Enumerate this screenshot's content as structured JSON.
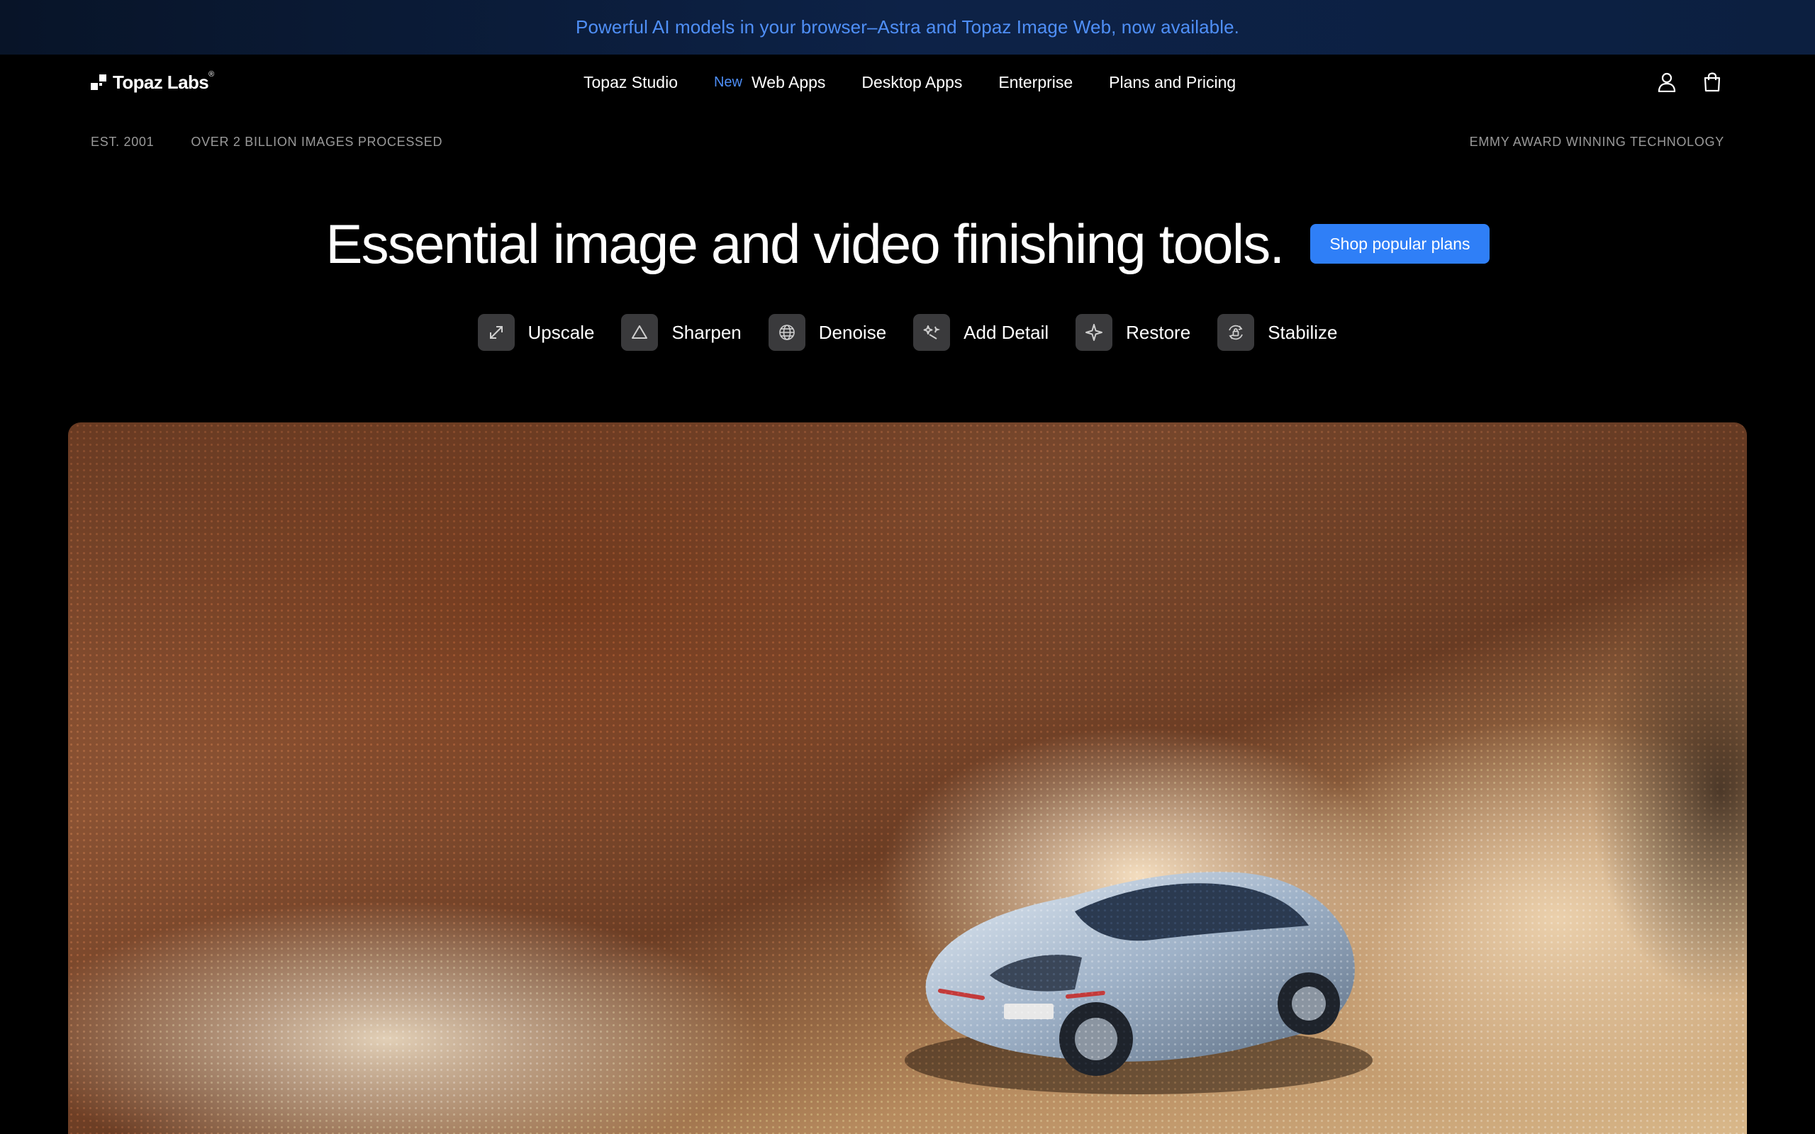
{
  "banner": {
    "text": "Powerful AI models in your browser–Astra and Topaz Image Web, now available."
  },
  "header": {
    "logo_text": "Topaz Labs",
    "logo_mark": "®",
    "nav": [
      {
        "label": "Topaz Studio",
        "badge": ""
      },
      {
        "label": "Web Apps",
        "badge": "New"
      },
      {
        "label": "Desktop Apps",
        "badge": ""
      },
      {
        "label": "Enterprise",
        "badge": ""
      },
      {
        "label": "Plans and Pricing",
        "badge": ""
      }
    ],
    "icons": [
      "user-icon",
      "shopping-bag-icon"
    ]
  },
  "meta": {
    "established": "EST. 2001",
    "images_processed": "OVER 2 BILLION IMAGES PROCESSED",
    "award": "EMMY AWARD WINNING TECHNOLOGY"
  },
  "hero": {
    "title": "Essential image and video finishing tools.",
    "cta_label": "Shop popular plans",
    "cta_color": "#2f7ff7"
  },
  "tools": [
    {
      "label": "Upscale",
      "icon": "expand-arrows-icon"
    },
    {
      "label": "Sharpen",
      "icon": "triangle-icon"
    },
    {
      "label": "Denoise",
      "icon": "globe-grid-icon"
    },
    {
      "label": "Add Detail",
      "icon": "sparkle-wand-icon"
    },
    {
      "label": "Restore",
      "icon": "sparkle-star-icon"
    },
    {
      "label": "Stabilize",
      "icon": "rotate-lock-icon"
    }
  ],
  "media": {
    "subject": "silver-sports-car-image"
  },
  "colors": {
    "accent": "#2f7ff7",
    "banner_text": "#4f8ff7",
    "background": "#000000"
  }
}
